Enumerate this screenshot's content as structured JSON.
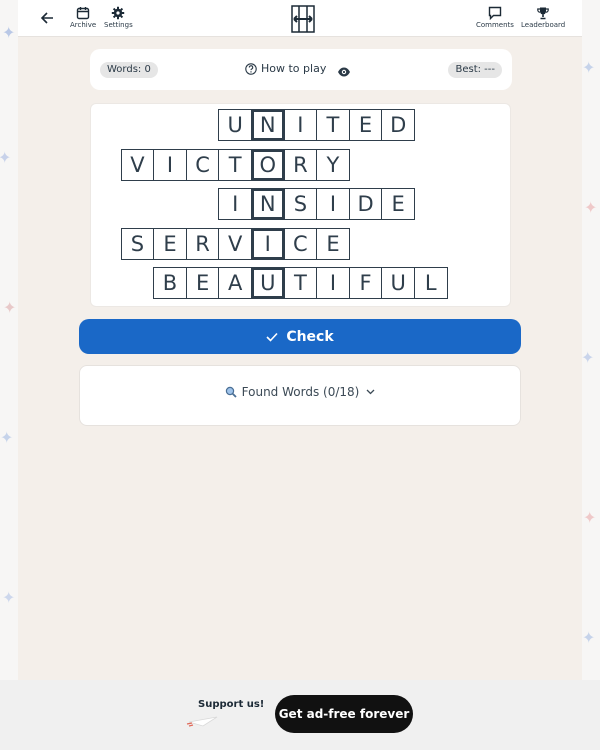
{
  "header": {
    "archive_label": "Archive",
    "settings_label": "Settings",
    "comments_label": "Comments",
    "leaderboard_label": "Leaderboard"
  },
  "status": {
    "words": "Words: 0",
    "how_to_play": "How to play",
    "best": "Best: ---"
  },
  "puzzle": {
    "rows": [
      {
        "word": "UNITED",
        "key_index": 1
      },
      {
        "word": "VICTORY",
        "key_index": 4
      },
      {
        "word": "INSIDE",
        "key_index": 1
      },
      {
        "word": "SERVICE",
        "key_index": 4
      },
      {
        "word": "BEAUTIFUL",
        "key_index": 3
      }
    ]
  },
  "check_label": "Check",
  "found": {
    "label": "Found Words (0/18)"
  },
  "footer": {
    "support_label": "Support us!",
    "adfree_label": "Get ad-free forever"
  },
  "colors": {
    "primary": "#1a68c7",
    "ink": "#2f3e4b",
    "page_bg": "#f4efea"
  }
}
